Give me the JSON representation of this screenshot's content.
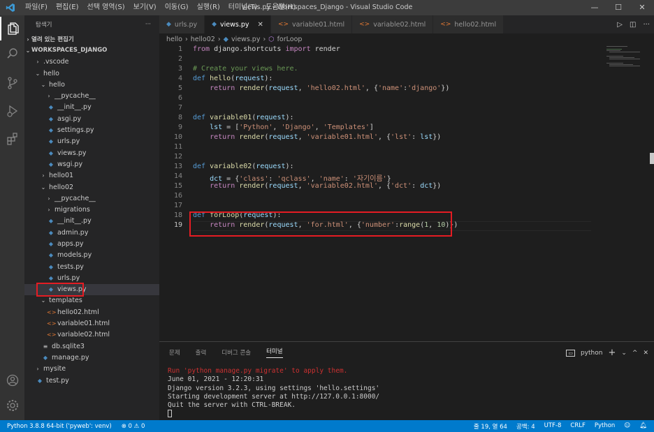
{
  "window": {
    "title": "views.py - Workspaces_Django - Visual Studio Code",
    "menu": [
      "파일(F)",
      "편집(E)",
      "선택 영역(S)",
      "보기(V)",
      "이동(G)",
      "실행(R)",
      "터미널(T)",
      "도움말(H)"
    ],
    "controls": {
      "minimize": "—",
      "maximize": "☐",
      "close": "✕"
    }
  },
  "sidebar": {
    "title": "탐색기",
    "more": "···",
    "open_editors": "열려 있는 편집기",
    "workspace": "WORKSPACES_DJANGO",
    "tree": [
      {
        "label": ".vscode",
        "type": "folder",
        "open": false,
        "depth": 1
      },
      {
        "label": "hello",
        "type": "folder",
        "open": true,
        "depth": 1
      },
      {
        "label": "hello",
        "type": "folder",
        "open": true,
        "depth": 2
      },
      {
        "label": "__pycache__",
        "type": "folder",
        "open": false,
        "depth": 3
      },
      {
        "label": "__init__.py",
        "type": "py",
        "depth": 3
      },
      {
        "label": "asgi.py",
        "type": "py",
        "depth": 3
      },
      {
        "label": "settings.py",
        "type": "py",
        "depth": 3
      },
      {
        "label": "urls.py",
        "type": "py",
        "depth": 3
      },
      {
        "label": "views.py",
        "type": "py",
        "depth": 3
      },
      {
        "label": "wsgi.py",
        "type": "py",
        "depth": 3
      },
      {
        "label": "hello01",
        "type": "folder",
        "open": false,
        "depth": 2
      },
      {
        "label": "hello02",
        "type": "folder",
        "open": true,
        "depth": 2
      },
      {
        "label": "__pycache__",
        "type": "folder",
        "open": false,
        "depth": 3
      },
      {
        "label": "migrations",
        "type": "folder",
        "open": false,
        "depth": 3
      },
      {
        "label": "__init__.py",
        "type": "py",
        "depth": 3
      },
      {
        "label": "admin.py",
        "type": "py",
        "depth": 3
      },
      {
        "label": "apps.py",
        "type": "py",
        "depth": 3
      },
      {
        "label": "models.py",
        "type": "py",
        "depth": 3
      },
      {
        "label": "tests.py",
        "type": "py",
        "depth": 3
      },
      {
        "label": "urls.py",
        "type": "py",
        "depth": 3
      },
      {
        "label": "views.py",
        "type": "py",
        "depth": 3,
        "selected": true
      },
      {
        "label": "templates",
        "type": "folder",
        "open": true,
        "depth": 2
      },
      {
        "label": "hello02.html",
        "type": "html",
        "depth": 3
      },
      {
        "label": "variable01.html",
        "type": "html",
        "depth": 3
      },
      {
        "label": "variable02.html",
        "type": "html",
        "depth": 3
      },
      {
        "label": "db.sqlite3",
        "type": "db",
        "depth": 2
      },
      {
        "label": "manage.py",
        "type": "py",
        "depth": 2
      },
      {
        "label": "mysite",
        "type": "folder",
        "open": false,
        "depth": 1
      },
      {
        "label": "test.py",
        "type": "py",
        "depth": 1
      }
    ]
  },
  "tabs": [
    {
      "label": "urls.py",
      "icon": "python-icon",
      "active": false
    },
    {
      "label": "views.py",
      "icon": "python-icon",
      "active": true
    },
    {
      "label": "variable01.html",
      "icon": "html-icon",
      "active": false
    },
    {
      "label": "variable02.html",
      "icon": "html-icon",
      "active": false
    },
    {
      "label": "hello02.html",
      "icon": "html-icon",
      "active": false
    }
  ],
  "tab_actions": {
    "run": "▷",
    "split": "◫",
    "more": "···"
  },
  "breadcrumb": [
    "hello",
    "hello02",
    "views.py",
    "forLoop"
  ],
  "editor": {
    "current_line": 19,
    "lines": [
      [
        {
          "t": "from",
          "c": "c"
        },
        {
          "t": " django.shortcuts ",
          "c": "t"
        },
        {
          "t": "import",
          "c": "c"
        },
        {
          "t": " render",
          "c": "t"
        }
      ],
      [],
      [
        {
          "t": "# Create your views here.",
          "c": "cm"
        }
      ],
      [
        {
          "t": "def",
          "c": "k"
        },
        {
          "t": " ",
          "c": "t"
        },
        {
          "t": "hello",
          "c": "f"
        },
        {
          "t": "(",
          "c": "t"
        },
        {
          "t": "request",
          "c": "p"
        },
        {
          "t": "):",
          "c": "t"
        }
      ],
      [
        {
          "t": "    ",
          "c": "t"
        },
        {
          "t": "return",
          "c": "c"
        },
        {
          "t": " ",
          "c": "t"
        },
        {
          "t": "render",
          "c": "f"
        },
        {
          "t": "(",
          "c": "t"
        },
        {
          "t": "request",
          "c": "p"
        },
        {
          "t": ", ",
          "c": "t"
        },
        {
          "t": "'hello02.html'",
          "c": "s"
        },
        {
          "t": ", {",
          "c": "t"
        },
        {
          "t": "'name'",
          "c": "s"
        },
        {
          "t": ":",
          "c": "t"
        },
        {
          "t": "'django'",
          "c": "s"
        },
        {
          "t": "})",
          "c": "t"
        }
      ],
      [],
      [],
      [
        {
          "t": "def",
          "c": "k"
        },
        {
          "t": " ",
          "c": "t"
        },
        {
          "t": "variable01",
          "c": "f"
        },
        {
          "t": "(",
          "c": "t"
        },
        {
          "t": "request",
          "c": "p"
        },
        {
          "t": "):",
          "c": "t"
        }
      ],
      [
        {
          "t": "    ",
          "c": "t"
        },
        {
          "t": "lst",
          "c": "p"
        },
        {
          "t": " = [",
          "c": "t"
        },
        {
          "t": "'Python'",
          "c": "s"
        },
        {
          "t": ", ",
          "c": "t"
        },
        {
          "t": "'Django'",
          "c": "s"
        },
        {
          "t": ", ",
          "c": "t"
        },
        {
          "t": "'Templates'",
          "c": "s"
        },
        {
          "t": "]",
          "c": "t"
        }
      ],
      [
        {
          "t": "    ",
          "c": "t"
        },
        {
          "t": "return",
          "c": "c"
        },
        {
          "t": " ",
          "c": "t"
        },
        {
          "t": "render",
          "c": "f"
        },
        {
          "t": "(",
          "c": "t"
        },
        {
          "t": "request",
          "c": "p"
        },
        {
          "t": ", ",
          "c": "t"
        },
        {
          "t": "'variable01.html'",
          "c": "s"
        },
        {
          "t": ", {",
          "c": "t"
        },
        {
          "t": "'lst'",
          "c": "s"
        },
        {
          "t": ": ",
          "c": "t"
        },
        {
          "t": "lst",
          "c": "p"
        },
        {
          "t": "})",
          "c": "t"
        }
      ],
      [],
      [],
      [
        {
          "t": "def",
          "c": "k"
        },
        {
          "t": " ",
          "c": "t"
        },
        {
          "t": "variable02",
          "c": "f"
        },
        {
          "t": "(",
          "c": "t"
        },
        {
          "t": "request",
          "c": "p"
        },
        {
          "t": "):",
          "c": "t"
        }
      ],
      [
        {
          "t": "    ",
          "c": "t"
        },
        {
          "t": "dct",
          "c": "p"
        },
        {
          "t": " = {",
          "c": "t"
        },
        {
          "t": "'class'",
          "c": "s"
        },
        {
          "t": ": ",
          "c": "t"
        },
        {
          "t": "'qclass'",
          "c": "s"
        },
        {
          "t": ", ",
          "c": "t"
        },
        {
          "t": "'name'",
          "c": "s"
        },
        {
          "t": ": ",
          "c": "t"
        },
        {
          "t": "'자기이름'",
          "c": "s"
        },
        {
          "t": "}",
          "c": "t"
        }
      ],
      [
        {
          "t": "    ",
          "c": "t"
        },
        {
          "t": "return",
          "c": "c"
        },
        {
          "t": " ",
          "c": "t"
        },
        {
          "t": "render",
          "c": "f"
        },
        {
          "t": "(",
          "c": "t"
        },
        {
          "t": "request",
          "c": "p"
        },
        {
          "t": ", ",
          "c": "t"
        },
        {
          "t": "'variable02.html'",
          "c": "s"
        },
        {
          "t": ", {",
          "c": "t"
        },
        {
          "t": "'dct'",
          "c": "s"
        },
        {
          "t": ": ",
          "c": "t"
        },
        {
          "t": "dct",
          "c": "p"
        },
        {
          "t": "})",
          "c": "t"
        }
      ],
      [],
      [],
      [
        {
          "t": "def",
          "c": "k"
        },
        {
          "t": " ",
          "c": "t"
        },
        {
          "t": "forLoop",
          "c": "f"
        },
        {
          "t": "(",
          "c": "t"
        },
        {
          "t": "request",
          "c": "p"
        },
        {
          "t": "):",
          "c": "t"
        }
      ],
      [
        {
          "t": "    ",
          "c": "t"
        },
        {
          "t": "return",
          "c": "c"
        },
        {
          "t": " ",
          "c": "t"
        },
        {
          "t": "render",
          "c": "f"
        },
        {
          "t": "(",
          "c": "t"
        },
        {
          "t": "request",
          "c": "p"
        },
        {
          "t": ", ",
          "c": "t"
        },
        {
          "t": "'for.html'",
          "c": "s"
        },
        {
          "t": ", {",
          "c": "t"
        },
        {
          "t": "'number'",
          "c": "s"
        },
        {
          "t": ":",
          "c": "t"
        },
        {
          "t": "range",
          "c": "f"
        },
        {
          "t": "(",
          "c": "t"
        },
        {
          "t": "1",
          "c": "n"
        },
        {
          "t": ", ",
          "c": "t"
        },
        {
          "t": "10",
          "c": "n"
        },
        {
          "t": ")})",
          "c": "t"
        }
      ]
    ]
  },
  "panel": {
    "tabs": [
      "문제",
      "출력",
      "디버그 콘솔",
      "터미널"
    ],
    "active_tab": 3,
    "terminal_name": "python",
    "actions": {
      "add": "+",
      "dropdown": "⌄",
      "maximize": "^",
      "close": "✕"
    },
    "terminal_lines": [
      {
        "text": "Run 'python manage.py migrate' to apply them.",
        "warn": true
      },
      {
        "text": "June 01, 2021 - 12:20:31",
        "warn": false
      },
      {
        "text": "Django version 3.2.3, using settings 'hello.settings'",
        "warn": false
      },
      {
        "text": "Starting development server at http://127.0.0.1:8000/",
        "warn": false
      },
      {
        "text": "Quit the server with CTRL-BREAK.",
        "warn": false
      }
    ]
  },
  "statusbar": {
    "interpreter": "Python 3.8.8 64-bit ('pyweb': venv)",
    "problems": "⊗ 0 ⚠ 0",
    "position": "줄 19, 열 64",
    "spaces": "공백: 4",
    "encoding": "UTF-8",
    "eol": "CRLF",
    "language": "Python"
  },
  "colors": {
    "accent": "#007acc",
    "highlight": "#e51c23"
  }
}
